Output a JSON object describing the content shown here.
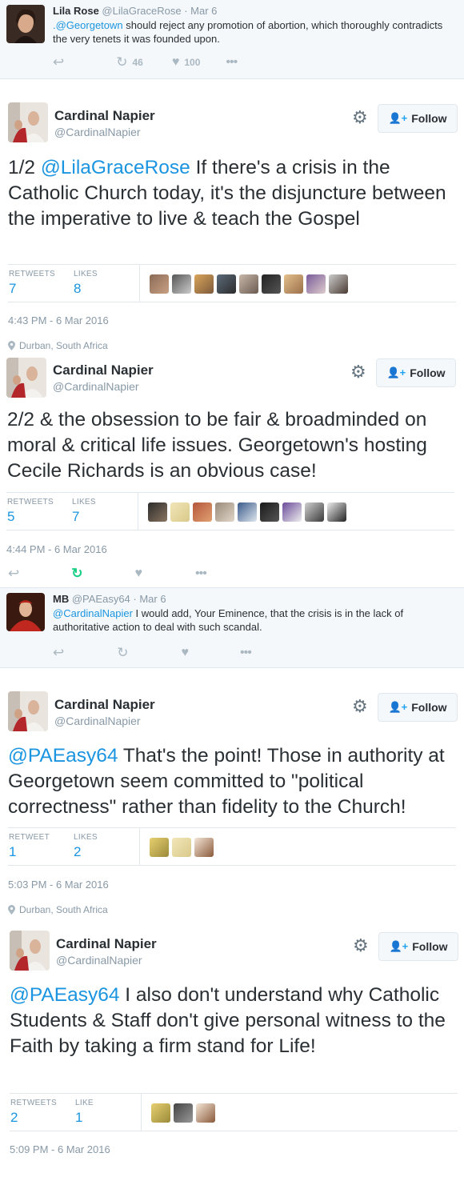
{
  "reply1": {
    "name": "Lila Rose",
    "handle": "@LilaGraceRose",
    "date": "· Mar 6",
    "mention": ".@Georgetown",
    "text": " should reject any promotion of abortion, which thoroughly contradicts the very tenets it was founded upon.",
    "retweets": "46",
    "likes": "100"
  },
  "tweet1": {
    "name": "Cardinal Napier",
    "handle": "@CardinalNapier",
    "follow_label": "Follow",
    "prefix": "1/2 ",
    "mention": "@LilaGraceRose",
    "text": " If there's a crisis in the Catholic Church today, it's the disjuncture between the imperative to live & teach the Gospel",
    "retweets_label": "RETWEETS",
    "retweets": "7",
    "likes_label": "LIKES",
    "likes": "8",
    "timestamp": "4:43 PM - 6 Mar 2016",
    "location": "Durban, South Africa"
  },
  "tweet2": {
    "name": "Cardinal Napier",
    "handle": "@CardinalNapier",
    "follow_label": "Follow",
    "text": "2/2 & the obsession to be fair & broadminded on moral & critical life issues. Georgetown's hosting Cecile Richards is an obvious case!",
    "retweets_label": "RETWEETS",
    "retweets": "5",
    "likes_label": "LIKES",
    "likes": "7",
    "timestamp": "4:44 PM - 6 Mar 2016"
  },
  "reply2": {
    "name": "MB",
    "handle": "@PAEasy64",
    "date": "· Mar 6",
    "mention": "@CardinalNapier",
    "text": " I would add, Your Eminence, that the crisis is in the lack of authoritative action to deal with such scandal."
  },
  "tweet3": {
    "name": "Cardinal Napier",
    "handle": "@CardinalNapier",
    "follow_label": "Follow",
    "mention": "@PAEasy64",
    "text": " That's the point! Those in authority at Georgetown seem committed to \"political correctness\" rather than fidelity to the Church!",
    "retweets_label": "RETWEET",
    "retweets": "1",
    "likes_label": "LIKES",
    "likes": "2",
    "timestamp": "5:03 PM - 6 Mar 2016",
    "location": "Durban, South Africa"
  },
  "tweet4": {
    "name": "Cardinal Napier",
    "handle": "@CardinalNapier",
    "follow_label": "Follow",
    "mention": "@PAEasy64",
    "text": " I also don't understand why Catholic Students & Staff don't give personal witness to the Faith by taking a firm stand for Life!",
    "retweets_label": "RETWEETS",
    "retweets": "2",
    "likes_label": "LIKE",
    "likes": "1",
    "timestamp": "5:09 PM - 6 Mar 2016"
  },
  "colors": {
    "link": "#1b95e0",
    "retweeted": "#19cf86",
    "muted": "#8899a6"
  },
  "icons": [
    "reply-icon",
    "retweet-icon",
    "heart-icon",
    "more-icon",
    "gear-icon",
    "follow-person-icon",
    "location-pin-icon"
  ]
}
